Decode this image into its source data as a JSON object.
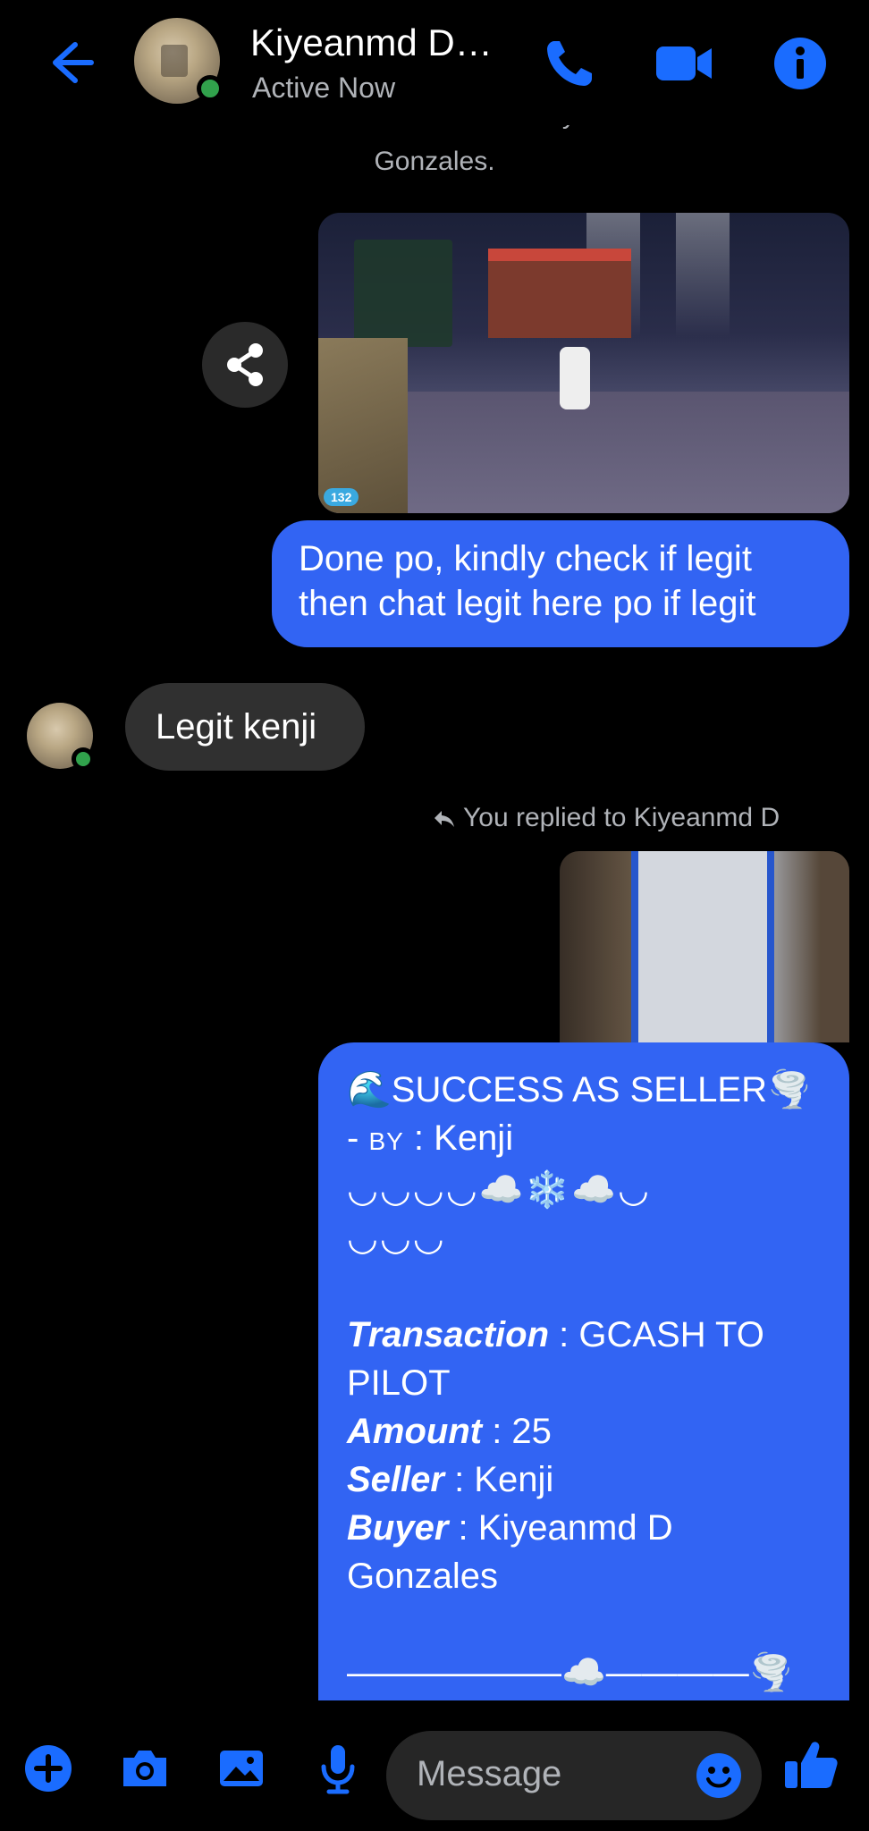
{
  "header": {
    "title": "Kiyeanmd D…",
    "status": "Active Now"
  },
  "system": {
    "line1": "You cleared the nickname for Kiyeanmd D",
    "line2": "Gonzales."
  },
  "messages": {
    "outgoing_1": [
      "Done po, kindly check if legit",
      "then chat legit here po if legit"
    ],
    "incoming_1": "Legit kenji",
    "reply_note": "You replied to Kiyeanmd D",
    "card": {
      "title": "🌊SUCCESS AS SELLER🌪️",
      "by_prefix": "- ",
      "by_label": "BY",
      "by_value": " : Kenji",
      "deco_1": "◡◡◡◡☁️❄️☁️◡",
      "deco_2": "◡◡◡",
      "transaction_label": "Transaction",
      "transaction_value": " : GCASH TO",
      "transaction_value_2": "PILOT",
      "amount_label": "Amount",
      "amount_value": " : 25",
      "seller_label": "Seller",
      "seller_value": " : Kenji",
      "buyer_label": "Buyer",
      "buyer_value": " : Kiyeanmd D",
      "buyer_value_2": "Gonzales",
      "footer_line": "——————☁️————🌪️"
    }
  },
  "game_image": {
    "badge": "132"
  },
  "composer": {
    "placeholder": "Message"
  },
  "colors": {
    "accent": "#3264f3",
    "icon_blue": "#1a6cff",
    "online": "#31a24c"
  }
}
